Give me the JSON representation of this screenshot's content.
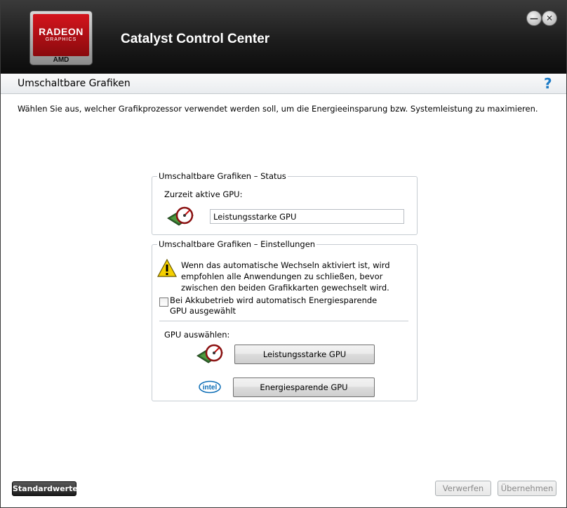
{
  "window": {
    "app_title": "Catalyst Control Center",
    "logo": {
      "line1": "RADEON",
      "line2": "GRAPHICS",
      "brand": "AMD"
    },
    "controls": {
      "minimize_icon": "minimize-icon",
      "close_icon": "close-icon",
      "minimize_glyph": "—",
      "close_glyph": "✕"
    }
  },
  "section": {
    "title": "Umschaltbare Grafiken",
    "help_glyph": "?"
  },
  "description": "Wählen Sie aus, welcher Grafikprozessor verwendet werden soll, um die Energieeinsparung bzw. Systemleistung zu maximieren.",
  "status_group": {
    "legend": "Umschaltbare Grafiken – Status",
    "active_gpu_label": "Zurzeit aktive GPU:",
    "active_gpu_value": "Leistungsstarke GPU"
  },
  "settings_group": {
    "legend": "Umschaltbare Grafiken – Einstellungen",
    "warning_text": "Wenn das automatische Wechseln aktiviert ist, wird empfohlen alle Anwendungen zu schließen, bevor zwischen den beiden Grafikkarten gewechselt wird.",
    "battery_checkbox_label": "Bei Akkubetrieb wird automatisch Energiesparende GPU ausgewählt",
    "battery_checkbox_checked": false,
    "select_gpu_label": "GPU auswählen:",
    "high_perf_button": "Leistungsstarke GPU",
    "power_saving_button": "Energiesparende GPU",
    "intel_logo_text": "intel"
  },
  "footer": {
    "defaults_button": "Standardwerte",
    "discard_button": "Verwerfen",
    "apply_button": "Übernehmen"
  },
  "colors": {
    "accent_red": "#d4141c",
    "help_blue": "#1c7bc6",
    "intel_blue": "#0a6cb5",
    "warning_yellow": "#f5d000"
  }
}
